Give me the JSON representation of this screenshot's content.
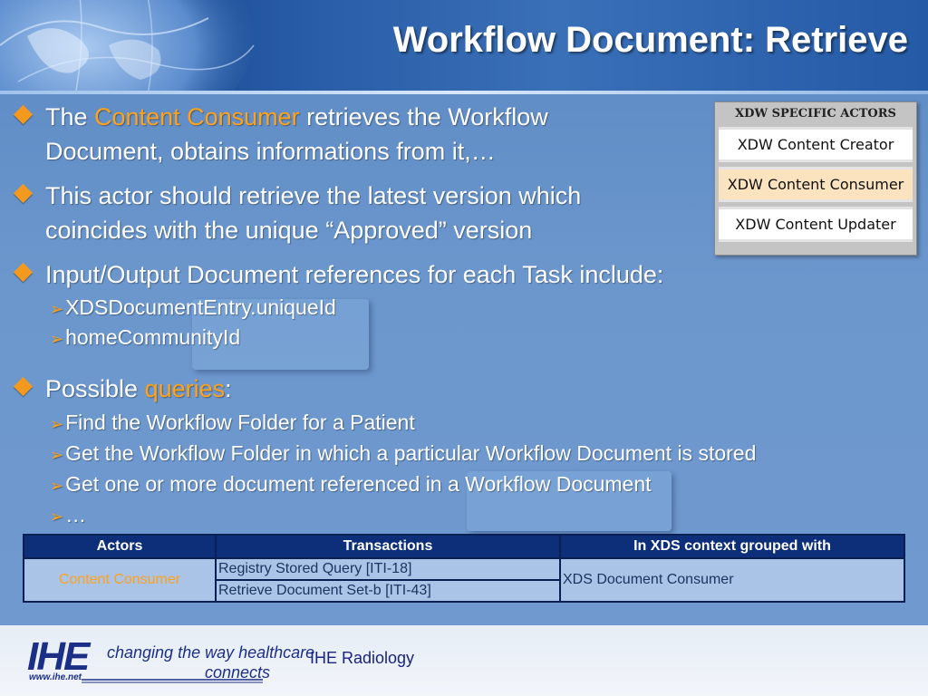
{
  "title": "Workflow Document: Retrieve",
  "bullets": [
    {
      "line1_pre": "The ",
      "line1_highlight": "Content Consumer",
      "line1_post": " retrieves the Workflow",
      "line2": "Document, obtains informations from it,…"
    },
    {
      "line1": "This actor should retrieve the latest version which",
      "line2": "coincides with the unique “Approved” version"
    },
    {
      "line1": "Input/Output Document references for each Task include:",
      "subs": [
        "XDSDocumentEntry.uniqueId",
        "homeCommunityId"
      ]
    },
    {
      "pre": "Possible ",
      "highlight": "queries",
      "post": ":",
      "subs": [
        "Find the Workflow Folder for a Patient",
        "Get the Workflow Folder in which a particular Workflow Document is stored",
        "Get one or more document referenced in a Workflow Document",
        "…"
      ]
    }
  ],
  "actors_panel": {
    "title": "XDW SPECIFIC ACTORS",
    "items": [
      "XDW Content Creator",
      "XDW Content Consumer",
      "XDW Content Updater"
    ],
    "active_index": 1
  },
  "table": {
    "headers": [
      "Actors",
      "Transactions",
      "In XDS context grouped with"
    ],
    "actor": "Content Consumer",
    "transactions": [
      "Registry Stored Query [ITI-18]",
      "Retrieve Document Set-b [ITI-43]"
    ],
    "grouped_with": "XDS Document Consumer"
  },
  "footer": {
    "logo_text": "IHE",
    "logo_url": "www.ihe.net",
    "tagline": "changing the way healthcare",
    "tagline2": "connects",
    "label": "IHE Radiology"
  },
  "colors": {
    "highlight": "#ffa21a",
    "header_bg": "#0d2f7a",
    "brand": "#1c2f86"
  }
}
